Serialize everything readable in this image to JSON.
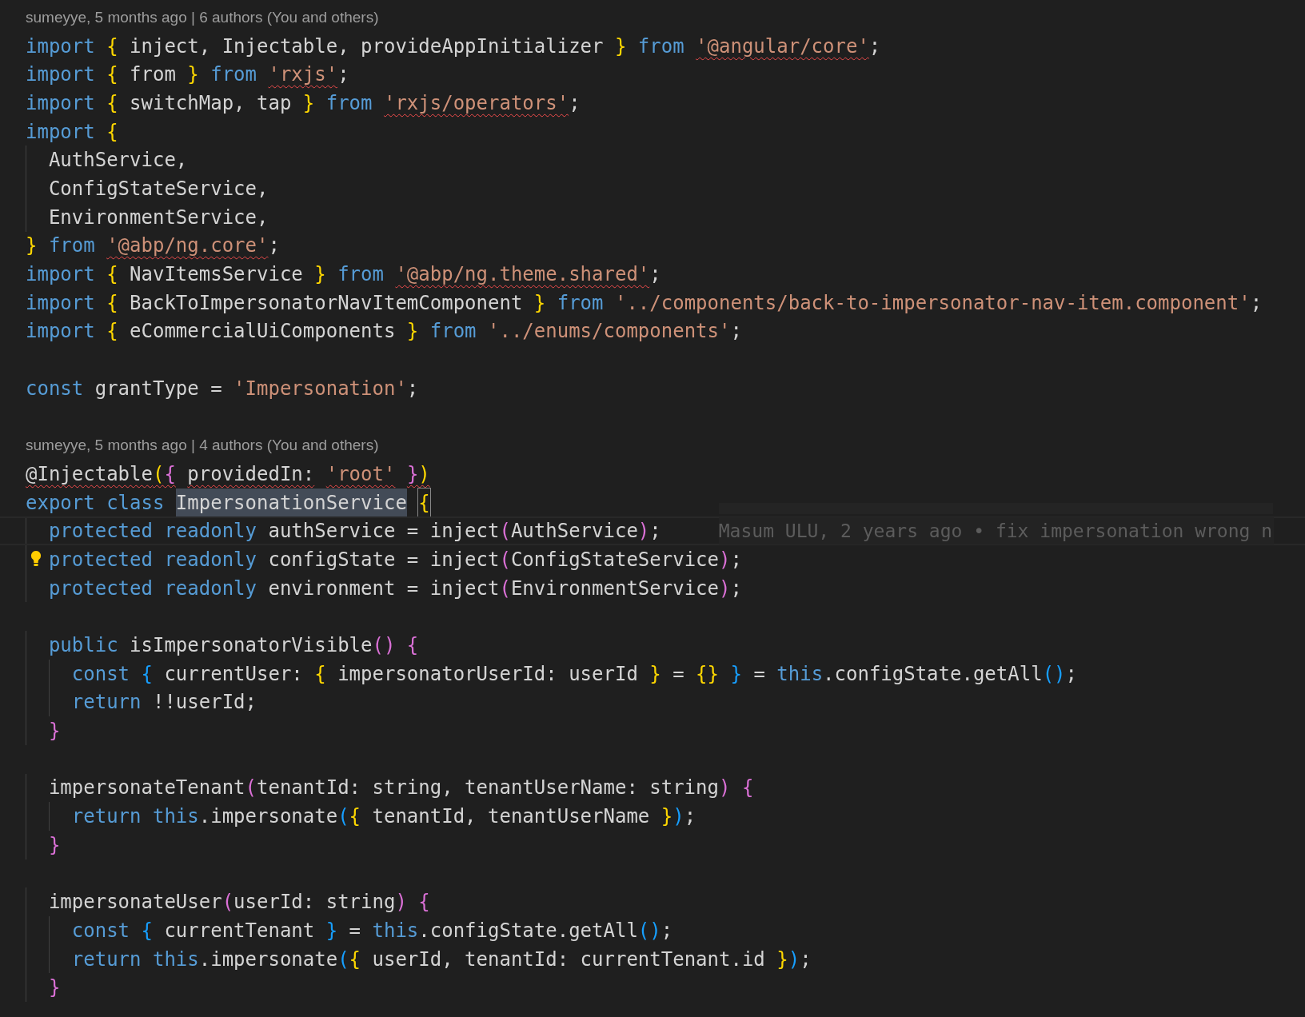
{
  "editor": {
    "lines": [
      {
        "kind": "codelens",
        "text": "sumeyye, 5 months ago | 6 authors (You and others)"
      },
      {
        "kind": "code",
        "tokens": [
          {
            "text": "import",
            "kind": "keyword"
          },
          {
            "text": " {",
            "kind": "bracket1"
          },
          {
            "text": " inject, Injectable, provideAppInitializer ",
            "kind": "plain"
          },
          {
            "text": "}",
            "kind": "bracket1"
          },
          {
            "text": " from ",
            "kind": "keyword"
          },
          {
            "text": "'@angular/core'",
            "kind": "string",
            "error": true
          },
          {
            "text": ";",
            "kind": "plain"
          }
        ]
      },
      {
        "kind": "code",
        "tokens": [
          {
            "text": "import",
            "kind": "keyword"
          },
          {
            "text": " {",
            "kind": "bracket1"
          },
          {
            "text": " from ",
            "kind": "plain"
          },
          {
            "text": "}",
            "kind": "bracket1"
          },
          {
            "text": " from ",
            "kind": "keyword"
          },
          {
            "text": "'rxjs'",
            "kind": "string",
            "error": true
          },
          {
            "text": ";",
            "kind": "plain"
          }
        ]
      },
      {
        "kind": "code",
        "tokens": [
          {
            "text": "import",
            "kind": "keyword"
          },
          {
            "text": " {",
            "kind": "bracket1"
          },
          {
            "text": " switchMap, tap ",
            "kind": "plain"
          },
          {
            "text": "}",
            "kind": "bracket1"
          },
          {
            "text": " from ",
            "kind": "keyword"
          },
          {
            "text": "'rxjs/operators'",
            "kind": "string",
            "error": true
          },
          {
            "text": ";",
            "kind": "plain"
          }
        ]
      },
      {
        "kind": "code",
        "tokens": [
          {
            "text": "import",
            "kind": "keyword"
          },
          {
            "text": " {",
            "kind": "bracket1"
          }
        ]
      },
      {
        "kind": "code",
        "tokens": [
          {
            "text": "  AuthService,",
            "kind": "plain"
          }
        ]
      },
      {
        "kind": "code",
        "tokens": [
          {
            "text": "  ConfigStateService,",
            "kind": "plain"
          }
        ]
      },
      {
        "kind": "code",
        "tokens": [
          {
            "text": "  EnvironmentService,",
            "kind": "plain"
          }
        ]
      },
      {
        "kind": "code",
        "tokens": [
          {
            "text": "}",
            "kind": "bracket1"
          },
          {
            "text": " from ",
            "kind": "keyword"
          },
          {
            "text": "'@abp/ng.core'",
            "kind": "string",
            "error": true
          },
          {
            "text": ";",
            "kind": "plain"
          }
        ]
      },
      {
        "kind": "code",
        "tokens": [
          {
            "text": "import",
            "kind": "keyword"
          },
          {
            "text": " {",
            "kind": "bracket1"
          },
          {
            "text": " NavItemsService ",
            "kind": "plain"
          },
          {
            "text": "}",
            "kind": "bracket1"
          },
          {
            "text": " from ",
            "kind": "keyword"
          },
          {
            "text": "'@abp/ng.theme.shared'",
            "kind": "string",
            "error": true
          },
          {
            "text": ";",
            "kind": "plain"
          }
        ]
      },
      {
        "kind": "code",
        "tokens": [
          {
            "text": "import",
            "kind": "keyword"
          },
          {
            "text": " {",
            "kind": "bracket1"
          },
          {
            "text": " BackToImpersonatorNavItemComponent ",
            "kind": "plain"
          },
          {
            "text": "}",
            "kind": "bracket1"
          },
          {
            "text": " from ",
            "kind": "keyword"
          },
          {
            "text": "'../components/back-to-impersonator-nav-item.component'",
            "kind": "string"
          },
          {
            "text": ";",
            "kind": "plain"
          }
        ]
      },
      {
        "kind": "code",
        "tokens": [
          {
            "text": "import",
            "kind": "keyword"
          },
          {
            "text": " {",
            "kind": "bracket1"
          },
          {
            "text": " eCommercialUiComponents ",
            "kind": "plain"
          },
          {
            "text": "}",
            "kind": "bracket1"
          },
          {
            "text": " from ",
            "kind": "keyword"
          },
          {
            "text": "'../enums/components'",
            "kind": "string"
          },
          {
            "text": ";",
            "kind": "plain"
          }
        ]
      },
      {
        "kind": "blank"
      },
      {
        "kind": "code",
        "tokens": [
          {
            "text": "const",
            "kind": "keyword"
          },
          {
            "text": " grantType = ",
            "kind": "plain"
          },
          {
            "text": "'Impersonation'",
            "kind": "string"
          },
          {
            "text": ";",
            "kind": "plain"
          }
        ]
      },
      {
        "kind": "blank"
      },
      {
        "kind": "codelens",
        "text": "sumeyye, 5 months ago | 4 authors (You and others)"
      },
      {
        "kind": "code",
        "tokens": [
          {
            "text": "@Injectable",
            "kind": "plain",
            "error": true
          },
          {
            "text": "(",
            "kind": "bracket1",
            "error": true
          },
          {
            "text": "{",
            "kind": "bracket2",
            "error": true
          },
          {
            "text": " providedIn: ",
            "kind": "plain",
            "error": true
          },
          {
            "text": "'root'",
            "kind": "string",
            "error": true
          },
          {
            "text": " }",
            "kind": "bracket2",
            "error": true
          },
          {
            "text": ")",
            "kind": "bracket1",
            "error": true
          }
        ]
      },
      {
        "kind": "code",
        "tokens": [
          {
            "text": "export class",
            "kind": "keyword"
          },
          {
            "text": " ImpersonationService",
            "kind": "plain",
            "highlighted": true
          },
          {
            "text": " {",
            "kind": "bracket1",
            "matched": true
          }
        ]
      },
      {
        "kind": "code",
        "current": true,
        "blame": "Masum ULU, 2 years ago • fix impersonation wrong n",
        "tokens": [
          {
            "text": "  protected readonly",
            "kind": "keyword"
          },
          {
            "text": " authService = inject",
            "kind": "plain"
          },
          {
            "text": "(",
            "kind": "bracket2"
          },
          {
            "text": "AuthService",
            "kind": "plain"
          },
          {
            "text": ")",
            "kind": "bracket2"
          },
          {
            "text": ";",
            "kind": "plain"
          }
        ]
      },
      {
        "kind": "code",
        "lightbulb": true,
        "tokens": [
          {
            "text": "  protected readonly",
            "kind": "keyword"
          },
          {
            "text": " configState = inject",
            "kind": "plain"
          },
          {
            "text": "(",
            "kind": "bracket2"
          },
          {
            "text": "ConfigStateService",
            "kind": "plain"
          },
          {
            "text": ")",
            "kind": "bracket2"
          },
          {
            "text": ";",
            "kind": "plain"
          }
        ]
      },
      {
        "kind": "code",
        "tokens": [
          {
            "text": "  protected readonly",
            "kind": "keyword"
          },
          {
            "text": " environment = inject",
            "kind": "plain"
          },
          {
            "text": "(",
            "kind": "bracket2"
          },
          {
            "text": "EnvironmentService",
            "kind": "plain"
          },
          {
            "text": ")",
            "kind": "bracket2"
          },
          {
            "text": ";",
            "kind": "plain"
          }
        ]
      },
      {
        "kind": "blank"
      },
      {
        "kind": "code",
        "tokens": [
          {
            "text": "  public",
            "kind": "keyword"
          },
          {
            "text": " isImpersonatorVisible",
            "kind": "plain"
          },
          {
            "text": "()",
            "kind": "bracket2"
          },
          {
            "text": " {",
            "kind": "bracket2"
          }
        ]
      },
      {
        "kind": "code",
        "tokens": [
          {
            "text": "    const",
            "kind": "keyword"
          },
          {
            "text": " {",
            "kind": "bracket3"
          },
          {
            "text": " currentUser: ",
            "kind": "plain"
          },
          {
            "text": "{",
            "kind": "bracket1"
          },
          {
            "text": " impersonatorUserId: userId ",
            "kind": "plain"
          },
          {
            "text": "}",
            "kind": "bracket1"
          },
          {
            "text": " = ",
            "kind": "plain"
          },
          {
            "text": "{}",
            "kind": "bracket1"
          },
          {
            "text": " }",
            "kind": "bracket3"
          },
          {
            "text": " = ",
            "kind": "plain"
          },
          {
            "text": "this",
            "kind": "keyword"
          },
          {
            "text": ".configState.getAll",
            "kind": "plain"
          },
          {
            "text": "()",
            "kind": "bracket3"
          },
          {
            "text": ";",
            "kind": "plain"
          }
        ]
      },
      {
        "kind": "code",
        "tokens": [
          {
            "text": "    return",
            "kind": "keyword"
          },
          {
            "text": " !!userId;",
            "kind": "plain"
          }
        ]
      },
      {
        "kind": "code",
        "tokens": [
          {
            "text": "  }",
            "kind": "bracket2"
          }
        ]
      },
      {
        "kind": "blank"
      },
      {
        "kind": "code",
        "tokens": [
          {
            "text": "  impersonateTenant",
            "kind": "plain"
          },
          {
            "text": "(",
            "kind": "bracket2"
          },
          {
            "text": "tenantId: string, tenantUserName: string",
            "kind": "plain"
          },
          {
            "text": ")",
            "kind": "bracket2"
          },
          {
            "text": " {",
            "kind": "bracket2"
          }
        ]
      },
      {
        "kind": "code",
        "tokens": [
          {
            "text": "    return",
            "kind": "keyword"
          },
          {
            "text": " this",
            "kind": "keyword"
          },
          {
            "text": ".impersonate",
            "kind": "plain"
          },
          {
            "text": "(",
            "kind": "bracket3"
          },
          {
            "text": "{",
            "kind": "bracket1"
          },
          {
            "text": " tenantId, tenantUserName ",
            "kind": "plain"
          },
          {
            "text": "}",
            "kind": "bracket1"
          },
          {
            "text": ")",
            "kind": "bracket3"
          },
          {
            "text": ";",
            "kind": "plain"
          }
        ]
      },
      {
        "kind": "code",
        "tokens": [
          {
            "text": "  }",
            "kind": "bracket2"
          }
        ]
      },
      {
        "kind": "blank"
      },
      {
        "kind": "code",
        "tokens": [
          {
            "text": "  impersonateUser",
            "kind": "plain"
          },
          {
            "text": "(",
            "kind": "bracket2"
          },
          {
            "text": "userId: string",
            "kind": "plain"
          },
          {
            "text": ")",
            "kind": "bracket2"
          },
          {
            "text": " {",
            "kind": "bracket2"
          }
        ]
      },
      {
        "kind": "code",
        "tokens": [
          {
            "text": "    const",
            "kind": "keyword"
          },
          {
            "text": " {",
            "kind": "bracket3"
          },
          {
            "text": " currentTenant ",
            "kind": "plain"
          },
          {
            "text": "}",
            "kind": "bracket3"
          },
          {
            "text": " = ",
            "kind": "plain"
          },
          {
            "text": "this",
            "kind": "keyword"
          },
          {
            "text": ".configState.getAll",
            "kind": "plain"
          },
          {
            "text": "()",
            "kind": "bracket3"
          },
          {
            "text": ";",
            "kind": "plain"
          }
        ]
      },
      {
        "kind": "code",
        "tokens": [
          {
            "text": "    return",
            "kind": "keyword"
          },
          {
            "text": " this",
            "kind": "keyword"
          },
          {
            "text": ".impersonate",
            "kind": "plain"
          },
          {
            "text": "(",
            "kind": "bracket3"
          },
          {
            "text": "{",
            "kind": "bracket1"
          },
          {
            "text": " userId, tenantId: currentTenant.id ",
            "kind": "plain"
          },
          {
            "text": "}",
            "kind": "bracket1"
          },
          {
            "text": ")",
            "kind": "bracket3"
          },
          {
            "text": ";",
            "kind": "plain"
          }
        ]
      },
      {
        "kind": "code",
        "tokens": [
          {
            "text": "  }",
            "kind": "bracket2"
          }
        ]
      }
    ]
  }
}
